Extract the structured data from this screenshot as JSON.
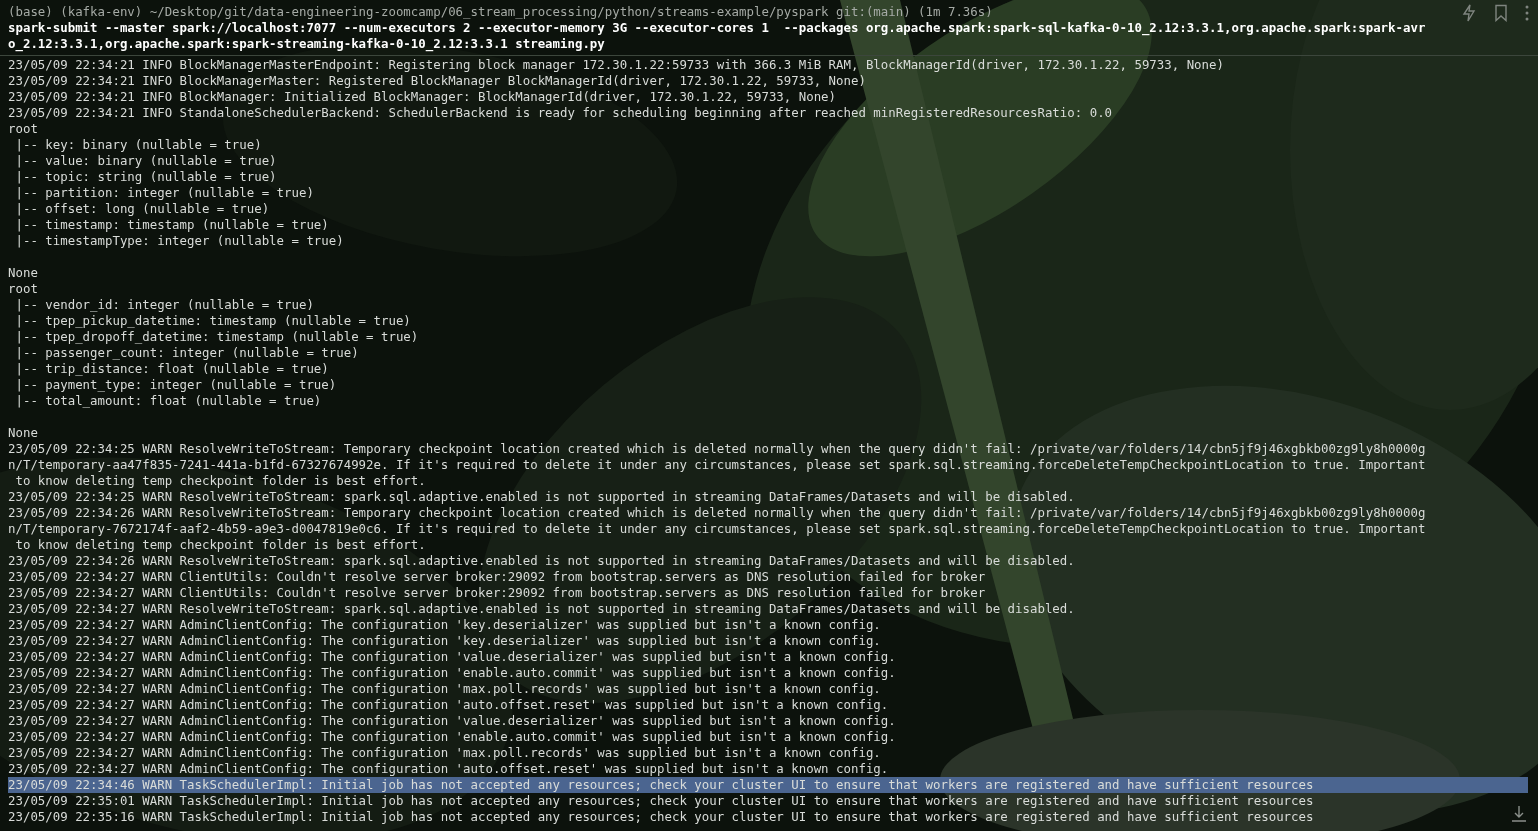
{
  "prompt": "(base) (kafka-env) ~/Desktop/git/data-engineering-zoomcamp/06_stream_processing/python/streams-example/pyspark git:(main) (1m 7.36s)",
  "command_lines": [
    "spark-submit --master spark://localhost:7077 --num-executors 2 --executor-memory 3G --executor-cores 1  --packages org.apache.spark:spark-sql-kafka-0-10_2.12:3.3.1,org.apache.spark:spark-avr",
    "o_2.12:3.3.1,org.apache.spark:spark-streaming-kafka-0-10_2.12:3.3.1 streaming.py"
  ],
  "output_lines": [
    {
      "kind": "text",
      "text": "23/05/09 22:34:21 INFO BlockManagerMasterEndpoint: Registering block manager 172.30.1.22:59733 with 366.3 MiB RAM, BlockManagerId(driver, 172.30.1.22, 59733, None)",
      "selected": false
    },
    {
      "kind": "text",
      "text": "23/05/09 22:34:21 INFO BlockManagerMaster: Registered BlockManager BlockManagerId(driver, 172.30.1.22, 59733, None)",
      "selected": false
    },
    {
      "kind": "text",
      "text": "23/05/09 22:34:21 INFO BlockManager: Initialized BlockManager: BlockManagerId(driver, 172.30.1.22, 59733, None)",
      "selected": false
    },
    {
      "kind": "text",
      "text": "23/05/09 22:34:21 INFO StandaloneSchedulerBackend: SchedulerBackend is ready for scheduling beginning after reached minRegisteredResourcesRatio: 0.0",
      "selected": false
    },
    {
      "kind": "text",
      "text": "root",
      "selected": false
    },
    {
      "kind": "text",
      "text": " |-- key: binary (nullable = true)",
      "selected": false
    },
    {
      "kind": "text",
      "text": " |-- value: binary (nullable = true)",
      "selected": false
    },
    {
      "kind": "text",
      "text": " |-- topic: string (nullable = true)",
      "selected": false
    },
    {
      "kind": "text",
      "text": " |-- partition: integer (nullable = true)",
      "selected": false
    },
    {
      "kind": "text",
      "text": " |-- offset: long (nullable = true)",
      "selected": false
    },
    {
      "kind": "text",
      "text": " |-- timestamp: timestamp (nullable = true)",
      "selected": false
    },
    {
      "kind": "text",
      "text": " |-- timestampType: integer (nullable = true)",
      "selected": false
    },
    {
      "kind": "blank"
    },
    {
      "kind": "text",
      "text": "None",
      "selected": false
    },
    {
      "kind": "text",
      "text": "root",
      "selected": false
    },
    {
      "kind": "text",
      "text": " |-- vendor_id: integer (nullable = true)",
      "selected": false
    },
    {
      "kind": "text",
      "text": " |-- tpep_pickup_datetime: timestamp (nullable = true)",
      "selected": false
    },
    {
      "kind": "text",
      "text": " |-- tpep_dropoff_datetime: timestamp (nullable = true)",
      "selected": false
    },
    {
      "kind": "text",
      "text": " |-- passenger_count: integer (nullable = true)",
      "selected": false
    },
    {
      "kind": "text",
      "text": " |-- trip_distance: float (nullable = true)",
      "selected": false
    },
    {
      "kind": "text",
      "text": " |-- payment_type: integer (nullable = true)",
      "selected": false
    },
    {
      "kind": "text",
      "text": " |-- total_amount: float (nullable = true)",
      "selected": false
    },
    {
      "kind": "blank"
    },
    {
      "kind": "text",
      "text": "None",
      "selected": false
    },
    {
      "kind": "text",
      "text": "23/05/09 22:34:25 WARN ResolveWriteToStream: Temporary checkpoint location created which is deleted normally when the query didn't fail: /private/var/folders/14/cbn5jf9j46xgbkb00zg9ly8h0000g",
      "selected": false
    },
    {
      "kind": "text",
      "text": "n/T/temporary-aa47f835-7241-441a-b1fd-67327674992e. If it's required to delete it under any circumstances, please set spark.sql.streaming.forceDeleteTempCheckpointLocation to true. Important",
      "selected": false
    },
    {
      "kind": "text",
      "text": " to know deleting temp checkpoint folder is best effort.",
      "selected": false
    },
    {
      "kind": "text",
      "text": "23/05/09 22:34:25 WARN ResolveWriteToStream: spark.sql.adaptive.enabled is not supported in streaming DataFrames/Datasets and will be disabled.",
      "selected": false
    },
    {
      "kind": "text",
      "text": "23/05/09 22:34:26 WARN ResolveWriteToStream: Temporary checkpoint location created which is deleted normally when the query didn't fail: /private/var/folders/14/cbn5jf9j46xgbkb00zg9ly8h0000g",
      "selected": false
    },
    {
      "kind": "text",
      "text": "n/T/temporary-7672174f-aaf2-4b59-a9e3-d0047819e0c6. If it's required to delete it under any circumstances, please set spark.sql.streaming.forceDeleteTempCheckpointLocation to true. Important",
      "selected": false
    },
    {
      "kind": "text",
      "text": " to know deleting temp checkpoint folder is best effort.",
      "selected": false
    },
    {
      "kind": "text",
      "text": "23/05/09 22:34:26 WARN ResolveWriteToStream: spark.sql.adaptive.enabled is not supported in streaming DataFrames/Datasets and will be disabled.",
      "selected": false
    },
    {
      "kind": "text",
      "text": "23/05/09 22:34:27 WARN ClientUtils: Couldn't resolve server broker:29092 from bootstrap.servers as DNS resolution failed for broker",
      "selected": false
    },
    {
      "kind": "text",
      "text": "23/05/09 22:34:27 WARN ClientUtils: Couldn't resolve server broker:29092 from bootstrap.servers as DNS resolution failed for broker",
      "selected": false
    },
    {
      "kind": "text",
      "text": "23/05/09 22:34:27 WARN ResolveWriteToStream: spark.sql.adaptive.enabled is not supported in streaming DataFrames/Datasets and will be disabled.",
      "selected": false
    },
    {
      "kind": "text",
      "text": "23/05/09 22:34:27 WARN AdminClientConfig: The configuration 'key.deserializer' was supplied but isn't a known config.",
      "selected": false
    },
    {
      "kind": "text",
      "text": "23/05/09 22:34:27 WARN AdminClientConfig: The configuration 'key.deserializer' was supplied but isn't a known config.",
      "selected": false
    },
    {
      "kind": "text",
      "text": "23/05/09 22:34:27 WARN AdminClientConfig: The configuration 'value.deserializer' was supplied but isn't a known config.",
      "selected": false
    },
    {
      "kind": "text",
      "text": "23/05/09 22:34:27 WARN AdminClientConfig: The configuration 'enable.auto.commit' was supplied but isn't a known config.",
      "selected": false
    },
    {
      "kind": "text",
      "text": "23/05/09 22:34:27 WARN AdminClientConfig: The configuration 'max.poll.records' was supplied but isn't a known config.",
      "selected": false
    },
    {
      "kind": "text",
      "text": "23/05/09 22:34:27 WARN AdminClientConfig: The configuration 'auto.offset.reset' was supplied but isn't a known config.",
      "selected": false
    },
    {
      "kind": "text",
      "text": "23/05/09 22:34:27 WARN AdminClientConfig: The configuration 'value.deserializer' was supplied but isn't a known config.",
      "selected": false
    },
    {
      "kind": "text",
      "text": "23/05/09 22:34:27 WARN AdminClientConfig: The configuration 'enable.auto.commit' was supplied but isn't a known config.",
      "selected": false
    },
    {
      "kind": "text",
      "text": "23/05/09 22:34:27 WARN AdminClientConfig: The configuration 'max.poll.records' was supplied but isn't a known config.",
      "selected": false
    },
    {
      "kind": "text",
      "text": "23/05/09 22:34:27 WARN AdminClientConfig: The configuration 'auto.offset.reset' was supplied but isn't a known config.",
      "selected": false
    },
    {
      "kind": "text",
      "text": "23/05/09 22:34:46 WARN TaskSchedulerImpl: Initial job has not accepted any resources; check your cluster UI to ensure that workers are registered and have sufficient resources",
      "selected": true
    },
    {
      "kind": "text",
      "text": "23/05/09 22:35:01 WARN TaskSchedulerImpl: Initial job has not accepted any resources; check your cluster UI to ensure that workers are registered and have sufficient resources",
      "selected": false
    },
    {
      "kind": "text",
      "text": "23/05/09 22:35:16 WARN TaskSchedulerImpl: Initial job has not accepted any resources; check your cluster UI to ensure that workers are registered and have sufficient resources",
      "selected": false
    }
  ]
}
